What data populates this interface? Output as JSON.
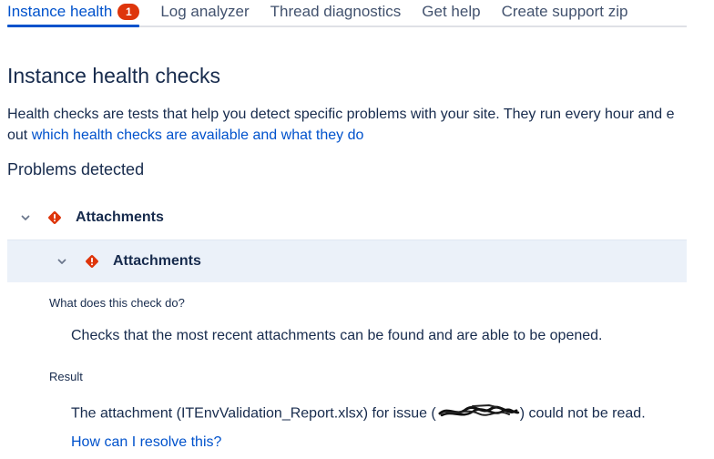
{
  "tabs": [
    {
      "label": "Instance health",
      "badge": "1",
      "active": true
    },
    {
      "label": "Log analyzer"
    },
    {
      "label": "Thread diagnostics"
    },
    {
      "label": "Get help"
    },
    {
      "label": "Create support zip"
    }
  ],
  "page_title": "Instance health checks",
  "intro": {
    "text_line1": "Health checks are tests that help you detect specific problems with your site. They run every hour and e",
    "text_line2_prefix": "out ",
    "link": "which health checks are available and what they do"
  },
  "problems_title": "Problems detected",
  "group": {
    "label": "Attachments",
    "icon": "error-diamond-icon"
  },
  "check": {
    "label": "Attachments",
    "icon": "error-diamond-icon",
    "what_label": "What does this check do?",
    "what_text": "Checks that the most recent attachments can be found and are able to be opened.",
    "result_label": "Result",
    "result_prefix": "The attachment (ITEnvValidation_Report.xlsx) for issue (",
    "result_suffix": ") could not be read.",
    "resolve_link": "How can I resolve this?"
  },
  "colors": {
    "accent": "#0052cc",
    "error": "#de350b",
    "selected_row": "#ebf1f9",
    "text": "#172b4d"
  }
}
